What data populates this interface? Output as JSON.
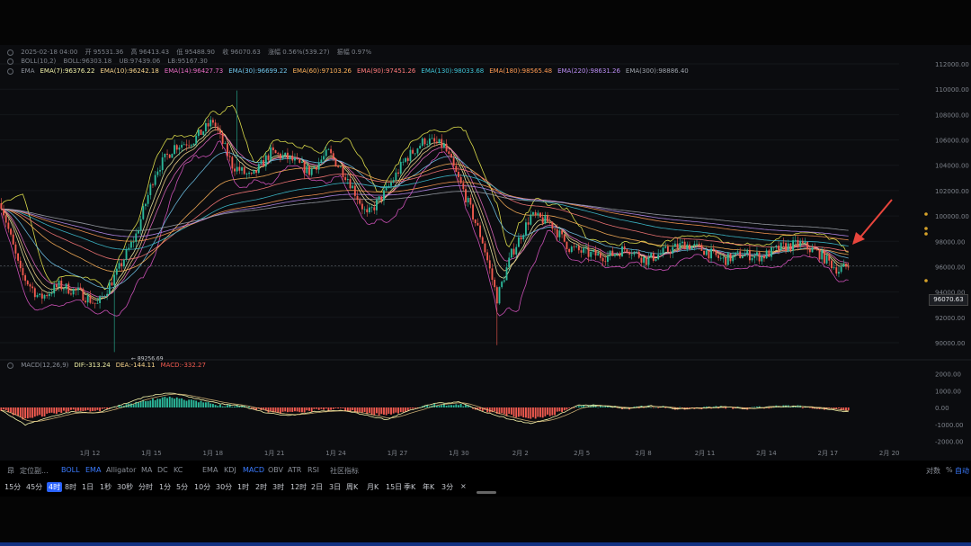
{
  "colors": {
    "background": "#0b0c0f",
    "up_candle": "#2bb89a",
    "down_candle": "#f05a4f",
    "macd_pos": "#2bb89a",
    "macd_neg": "#f05a4f",
    "ema7": "#f2f2a8",
    "ema10": "#f5d28a",
    "ema14": "#e86cc4",
    "ema30": "#6fc3e8",
    "ema60": "#ffb25a",
    "ema90": "#ff7b7b",
    "ema130": "#3ec1d3",
    "ema180": "#ff9a52",
    "ema220": "#b98cf2",
    "ema300": "#9ea3ab",
    "boll": "#d8d84a",
    "arrow": "#e8453c",
    "accent": "#2a63ff"
  },
  "header": {
    "ohlc": [
      "2025-02-18 04:00",
      "开 95531.36",
      "高 96413.43",
      "低 95488.90",
      "收 96070.63",
      "涨幅 0.56%(539.27)",
      "振幅 0.97%"
    ],
    "boll": [
      "BOLL(10,2)",
      "BOLL:96303.18",
      "UB:97439.06",
      "LB:95167.30"
    ],
    "ema": [
      {
        "label": "EMA",
        "color": "#8a8f98"
      },
      {
        "label": "EMA(7):96376.22",
        "color": "#f2f2a8"
      },
      {
        "label": "EMA(10):96242.18",
        "color": "#f5d28a"
      },
      {
        "label": "EMA(14):96427.73",
        "color": "#e86cc4"
      },
      {
        "label": "EMA(30):96699.22",
        "color": "#6fc3e8"
      },
      {
        "label": "EMA(60):97103.26",
        "color": "#ffb25a"
      },
      {
        "label": "EMA(90):97451.26",
        "color": "#ff7b7b"
      },
      {
        "label": "EMA(130):98033.68",
        "color": "#3ec1d3"
      },
      {
        "label": "EMA(180):98565.48",
        "color": "#ff9a52"
      },
      {
        "label": "EMA(220):98631.26",
        "color": "#b98cf2"
      },
      {
        "label": "EMA(300):98886.40",
        "color": "#9ea3ab"
      }
    ],
    "macd": [
      {
        "label": "MACD(12,26,9)",
        "color": "#8a8f98"
      },
      {
        "label": "DIF:-313.24",
        "color": "#f2f2a8"
      },
      {
        "label": "DEA:-144.11",
        "color": "#f5d28a"
      },
      {
        "label": "MACD:-332.27",
        "color": "#f05a4f"
      }
    ]
  },
  "chart_data": {
    "type": "candlestick",
    "timeframe": "4时",
    "y_ticks": [
      112000,
      110000,
      108000,
      106000,
      104000,
      102000,
      100000,
      98000,
      96000,
      94000,
      92000,
      90000
    ],
    "y_tick_labels": [
      "112000.00",
      "110000.00",
      "108000.00",
      "106000.00",
      "104000.00",
      "102000.00",
      "100000.00",
      "98000.00",
      "96000.00",
      "94000.00",
      "92000.00",
      "90000.00"
    ],
    "ylim": [
      89500,
      112500
    ],
    "x_labels": [
      "1月 12",
      "1月 15",
      "1月 18",
      "1月 21",
      "1月 24",
      "1月 27",
      "1月 30",
      "2月 2",
      "2月 5",
      "2月 8",
      "2月 11",
      "2月 14",
      "2月 17",
      "2月 20"
    ],
    "min_label": "← 89256.69",
    "last_price": "96070.63",
    "macd_ticks": [
      2000,
      1000,
      0,
      -1000,
      -2000
    ],
    "macd_tick_labels": [
      "2000.00",
      "1000.00",
      "0.00",
      "-1000.00",
      "-2000.00"
    ],
    "macd_ylim": [
      -2400,
      2400
    ],
    "price_anchors": [
      [
        0,
        101000
      ],
      [
        8,
        95500
      ],
      [
        16,
        93500
      ],
      [
        24,
        94500
      ],
      [
        32,
        94000
      ],
      [
        40,
        93000
      ],
      [
        48,
        95500
      ],
      [
        56,
        98500
      ],
      [
        64,
        103500
      ],
      [
        72,
        105500
      ],
      [
        80,
        106000
      ],
      [
        88,
        107500
      ],
      [
        96,
        104000
      ],
      [
        104,
        103000
      ],
      [
        112,
        105000
      ],
      [
        120,
        104500
      ],
      [
        128,
        103500
      ],
      [
        136,
        105000
      ],
      [
        144,
        103000
      ],
      [
        152,
        100000
      ],
      [
        160,
        102000
      ],
      [
        168,
        104500
      ],
      [
        176,
        106000
      ],
      [
        184,
        105500
      ],
      [
        192,
        102000
      ],
      [
        200,
        98000
      ],
      [
        206,
        93500
      ],
      [
        212,
        97000
      ],
      [
        220,
        100000
      ],
      [
        228,
        99500
      ],
      [
        236,
        97500
      ],
      [
        244,
        97000
      ],
      [
        252,
        96800
      ],
      [
        260,
        97500
      ],
      [
        268,
        96500
      ],
      [
        276,
        97200
      ],
      [
        284,
        97800
      ],
      [
        292,
        97300
      ],
      [
        300,
        96500
      ],
      [
        308,
        97000
      ],
      [
        316,
        96800
      ],
      [
        324,
        97500
      ],
      [
        332,
        97800
      ],
      [
        340,
        97000
      ],
      [
        348,
        95700
      ],
      [
        352,
        96070
      ]
    ],
    "macd_anchors": [
      [
        0,
        -200
      ],
      [
        10,
        -1300
      ],
      [
        20,
        -700
      ],
      [
        30,
        -300
      ],
      [
        40,
        -400
      ],
      [
        50,
        200
      ],
      [
        60,
        800
      ],
      [
        70,
        1100
      ],
      [
        80,
        700
      ],
      [
        90,
        300
      ],
      [
        100,
        100
      ],
      [
        110,
        -400
      ],
      [
        120,
        -600
      ],
      [
        130,
        -300
      ],
      [
        140,
        -200
      ],
      [
        150,
        -500
      ],
      [
        160,
        -900
      ],
      [
        170,
        -200
      ],
      [
        180,
        300
      ],
      [
        190,
        400
      ],
      [
        200,
        -300
      ],
      [
        210,
        -800
      ],
      [
        220,
        -1200
      ],
      [
        230,
        -700
      ],
      [
        240,
        200
      ],
      [
        250,
        150
      ],
      [
        260,
        -100
      ],
      [
        270,
        150
      ],
      [
        280,
        -100
      ],
      [
        290,
        -50
      ],
      [
        300,
        50
      ],
      [
        310,
        -100
      ],
      [
        320,
        50
      ],
      [
        330,
        100
      ],
      [
        340,
        -50
      ],
      [
        352,
        -330
      ]
    ]
  },
  "toolbar": {
    "indicators": [
      "昂",
      "定位副...",
      "BOLL",
      "EMA",
      "Alligator",
      "MA",
      "DC",
      "KC",
      "EMA",
      "KDJ",
      "MACD",
      "OBV",
      "ATR",
      "RSI",
      "社区指标"
    ],
    "right": [
      "对数",
      "%",
      "自动"
    ],
    "timeframes": [
      "15分",
      "45分",
      "4时",
      "8时",
      "1日",
      "1秒",
      "30秒",
      "分时",
      "1分",
      "5分",
      "10分",
      "30分",
      "1时",
      "2时",
      "3时",
      "12时",
      "2日",
      "3日",
      "周K",
      "月K",
      "15日",
      "季K",
      "年K",
      "3分",
      "×"
    ]
  }
}
